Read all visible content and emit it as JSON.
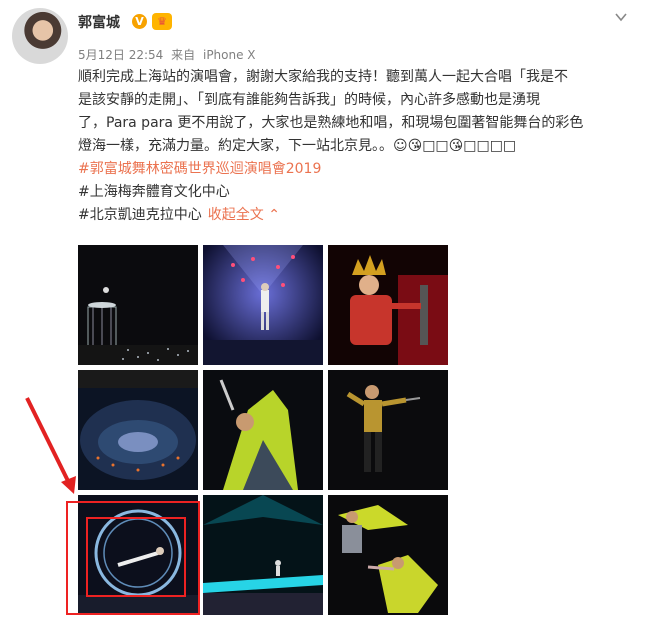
{
  "post": {
    "username": "郭富城",
    "verified_badge": "V",
    "fan_badge": "♛",
    "date": "5月12日 22:54",
    "source_prefix": "来自",
    "source": "iPhone X",
    "text_lines": [
      "順利完成上海站的演唱會，謝謝大家給我的支持！聽到萬人一起大合唱「我是不",
      "是該安靜的走開」、「到底有誰能夠告訴我」的時候，內心許多感動也是湧現",
      "了，Para para 更不用說了，大家也是熟練地和唱，和現場包圍著智能舞台的彩色",
      "燈海一樣，充滿力量。約定大家，下一站北京見。。☺😘□□😘□□□□"
    ],
    "tags": [
      "#郭富城舞林密碼世界巡迴演唱會2019",
      "#上海梅奔體育文化中心",
      "#北京凱迪克拉中心"
    ],
    "collapse_label": "收起全文",
    "collapse_arrow": "⌃"
  },
  "icons": {
    "menu": "chevron-down-icon",
    "verified": "verified-badge-icon",
    "fan": "fan-crown-icon"
  },
  "colors": {
    "accent": "#eb7350",
    "annotation": "#e22222"
  },
  "images": [
    {
      "name": "stage-cage-photo"
    },
    {
      "name": "blue-lights-photo"
    },
    {
      "name": "crown-costume-photo"
    },
    {
      "name": "arena-overview-photo"
    },
    {
      "name": "yellow-costume-photo"
    },
    {
      "name": "gold-suit-mic-photo"
    },
    {
      "name": "ring-stunt-photo"
    },
    {
      "name": "cyan-stage-photo"
    },
    {
      "name": "dancers-photo"
    }
  ]
}
